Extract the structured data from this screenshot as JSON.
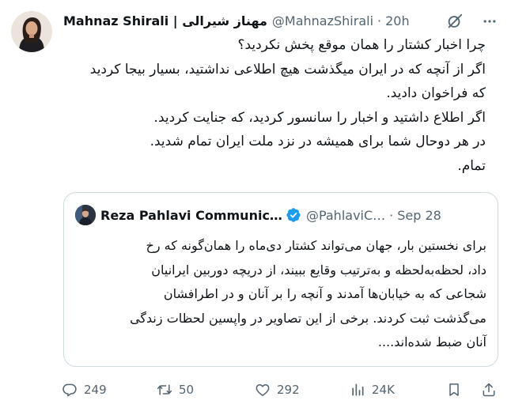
{
  "tweet": {
    "display_name": "Mahnaz Shirali | مهناز شیرالی",
    "handle": "@MahnazShirali",
    "separator": "·",
    "time": "20h",
    "lines": [
      "چرا اخبار کشتار را همان موقع پخش نکردید؟",
      "اگر از آنچه که در ایران میگذشت هیچ اطلاعی نداشتید، بسیار بیجا کردید",
      "که فراخوان دادید.",
      "اگر اطلاع داشتید و اخبار را سانسور کردید، که جنایت کردید.",
      "در هر دوحال شما برای همیشه در نزد ملت ایران تمام شدید.",
      "تمام."
    ]
  },
  "quote": {
    "display_name": "Reza Pahlavi Communic…",
    "handle": "@PahlaviC…",
    "separator": "·",
    "time": "Sep 28",
    "lines": [
      "برای نخستین بار، جهان می‌تواند کشتار دی‌ماه را همان‌گونه که رخ",
      "داد، لحظه‌به‌لحظه و به‌ترتیب وقایع ببیند، از دریچه دوربین ایرانیان",
      "شجاعی که به خیابان‌ها آمدند و آنچه را بر آنان و در اطرافشان",
      "می‌گذشت ثبت کردند. برخی از این تصاویر در واپسین لحظات زندگی",
      "آنان ضبط شده‌اند...."
    ]
  },
  "actions": {
    "replies": "249",
    "reposts": "50",
    "likes": "292",
    "views": "24K"
  },
  "icons": {
    "grok": "grok-icon",
    "more": "more-icon",
    "verified": "verified-badge-icon",
    "reply": "reply-icon",
    "repost": "repost-icon",
    "like": "heart-icon",
    "views": "views-icon",
    "bookmark": "bookmark-icon",
    "share": "share-icon"
  },
  "colors": {
    "text": "#0f1419",
    "secondary": "#536471",
    "border": "#cfd9de",
    "verified": "#1d9bf0"
  }
}
